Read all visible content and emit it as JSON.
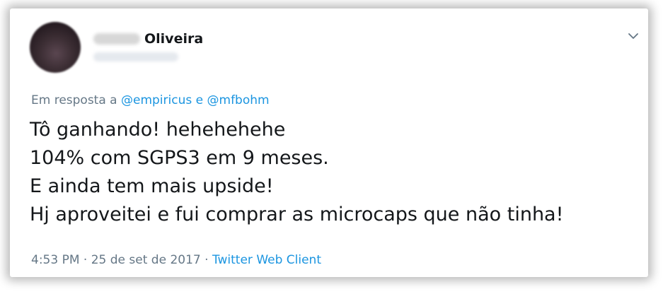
{
  "tweet": {
    "author": {
      "display_name_visible": "Oliveira"
    },
    "reply": {
      "prefix": "Em resposta a",
      "mention1": "@empiricus",
      "conjunction": "e",
      "mention2": "@mfbohm"
    },
    "lines": [
      "Tô ganhando! hehehehehe",
      "104% com SGPS3 em 9 meses.",
      "E ainda tem mais upside!",
      "Hj aproveitei e fui comprar as microcaps que não tinha!"
    ],
    "meta": {
      "time": "4:53 PM",
      "separator": "·",
      "date": "25 de set de 2017",
      "source": "Twitter Web Client"
    }
  },
  "icons": {
    "menu": "chevron-down-icon"
  },
  "colors": {
    "text": "#14171a",
    "secondary": "#657786",
    "link": "#1b95e0"
  }
}
